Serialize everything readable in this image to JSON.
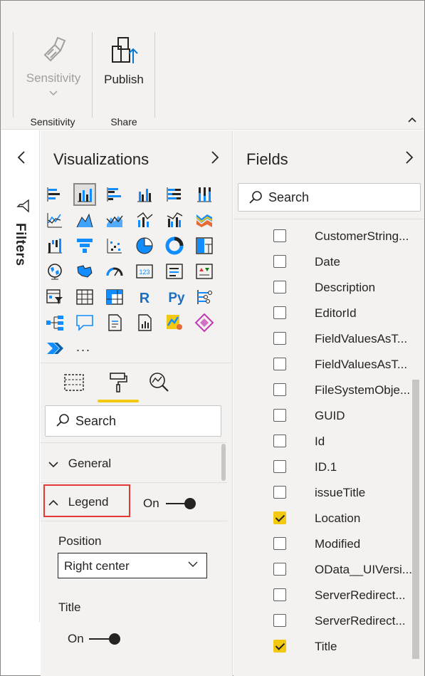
{
  "ribbon": {
    "sensitivity_button": "Sensitivity",
    "sensitivity_group": "Sensitivity",
    "publish_button": "Publish",
    "share_group": "Share"
  },
  "filters": {
    "label": "Filters"
  },
  "visualizations": {
    "title": "Visualizations",
    "more_label": "...",
    "search_placeholder": "Search",
    "sections": {
      "general": "General",
      "legend": "Legend",
      "legend_toggle": "On"
    },
    "legend": {
      "position_label": "Position",
      "position_value": "Right center",
      "title_label": "Title",
      "title_toggle": "On"
    }
  },
  "fields": {
    "title": "Fields",
    "search_placeholder": "Search",
    "items": [
      {
        "name": "CustomerString...",
        "checked": false
      },
      {
        "name": "Date",
        "checked": false
      },
      {
        "name": "Description",
        "checked": false
      },
      {
        "name": "EditorId",
        "checked": false
      },
      {
        "name": "FieldValuesAsT...",
        "checked": false
      },
      {
        "name": "FieldValuesAsT...",
        "checked": false
      },
      {
        "name": "FileSystemObje...",
        "checked": false
      },
      {
        "name": "GUID",
        "checked": false
      },
      {
        "name": "Id",
        "checked": false
      },
      {
        "name": "ID.1",
        "checked": false
      },
      {
        "name": "issueTitle",
        "checked": false
      },
      {
        "name": "Location",
        "checked": true
      },
      {
        "name": "Modified",
        "checked": false
      },
      {
        "name": "OData__UIVersi...",
        "checked": false
      },
      {
        "name": "ServerRedirect...",
        "checked": false
      },
      {
        "name": "ServerRedirect...",
        "checked": false
      },
      {
        "name": "Title",
        "checked": true
      }
    ]
  },
  "colors": {
    "accent": "#f2c811",
    "highlight": "#e53935",
    "pane_bg": "#f3f2f1"
  }
}
